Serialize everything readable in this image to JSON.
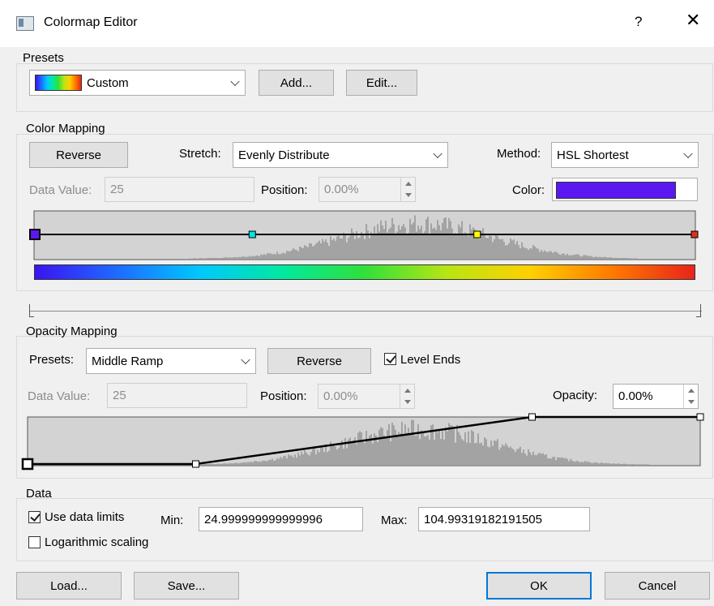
{
  "window": {
    "title": "Colormap Editor",
    "help_label": "?",
    "close_label": "✕"
  },
  "presets": {
    "group_label": "Presets",
    "selected": "Custom",
    "add_label": "Add...",
    "edit_label": "Edit..."
  },
  "color_mapping": {
    "group_label": "Color Mapping",
    "reverse_label": "Reverse",
    "stretch_label": "Stretch:",
    "stretch_value": "Evenly Distribute",
    "method_label": "Method:",
    "method_value": "HSL Shortest",
    "data_value_label": "Data Value:",
    "data_value": "25",
    "position_label": "Position:",
    "position_value": "0.00%",
    "color_label": "Color:",
    "color_value": "#5b19f0",
    "control_points": [
      {
        "position": 0.0,
        "color": "#5b19f0"
      },
      {
        "position": 0.33,
        "color": "#00e5e5"
      },
      {
        "position": 0.67,
        "color": "#ffff00"
      },
      {
        "position": 1.0,
        "color": "#e0301e"
      }
    ],
    "gradient_stops": [
      "#3b13f0",
      "#1e6bff",
      "#00c8ff",
      "#00e9a0",
      "#31e03a",
      "#b9e513",
      "#ffd000",
      "#ff7a00",
      "#e8241a"
    ]
  },
  "opacity_mapping": {
    "group_label": "Opacity Mapping",
    "presets_label": "Presets:",
    "preset_value": "Middle Ramp",
    "reverse_label": "Reverse",
    "level_ends_label": "Level Ends",
    "level_ends_checked": true,
    "data_value_label": "Data Value:",
    "data_value": "25",
    "position_label": "Position:",
    "position_value": "0.00%",
    "opacity_label": "Opacity:",
    "opacity_value": "0.00%",
    "control_points": [
      {
        "position": 0.0,
        "opacity": 0.0
      },
      {
        "position": 0.25,
        "opacity": 0.0
      },
      {
        "position": 0.75,
        "opacity": 1.0
      },
      {
        "position": 1.0,
        "opacity": 1.0
      }
    ]
  },
  "data": {
    "group_label": "Data",
    "use_limits_label": "Use data limits",
    "use_limits_checked": true,
    "min_label": "Min:",
    "min_value": "24.999999999999996",
    "max_label": "Max:",
    "max_value": "104.99319182191505",
    "log_label": "Logarithmic scaling",
    "log_checked": false
  },
  "footer": {
    "load_label": "Load...",
    "save_label": "Save...",
    "ok_label": "OK",
    "cancel_label": "Cancel"
  }
}
